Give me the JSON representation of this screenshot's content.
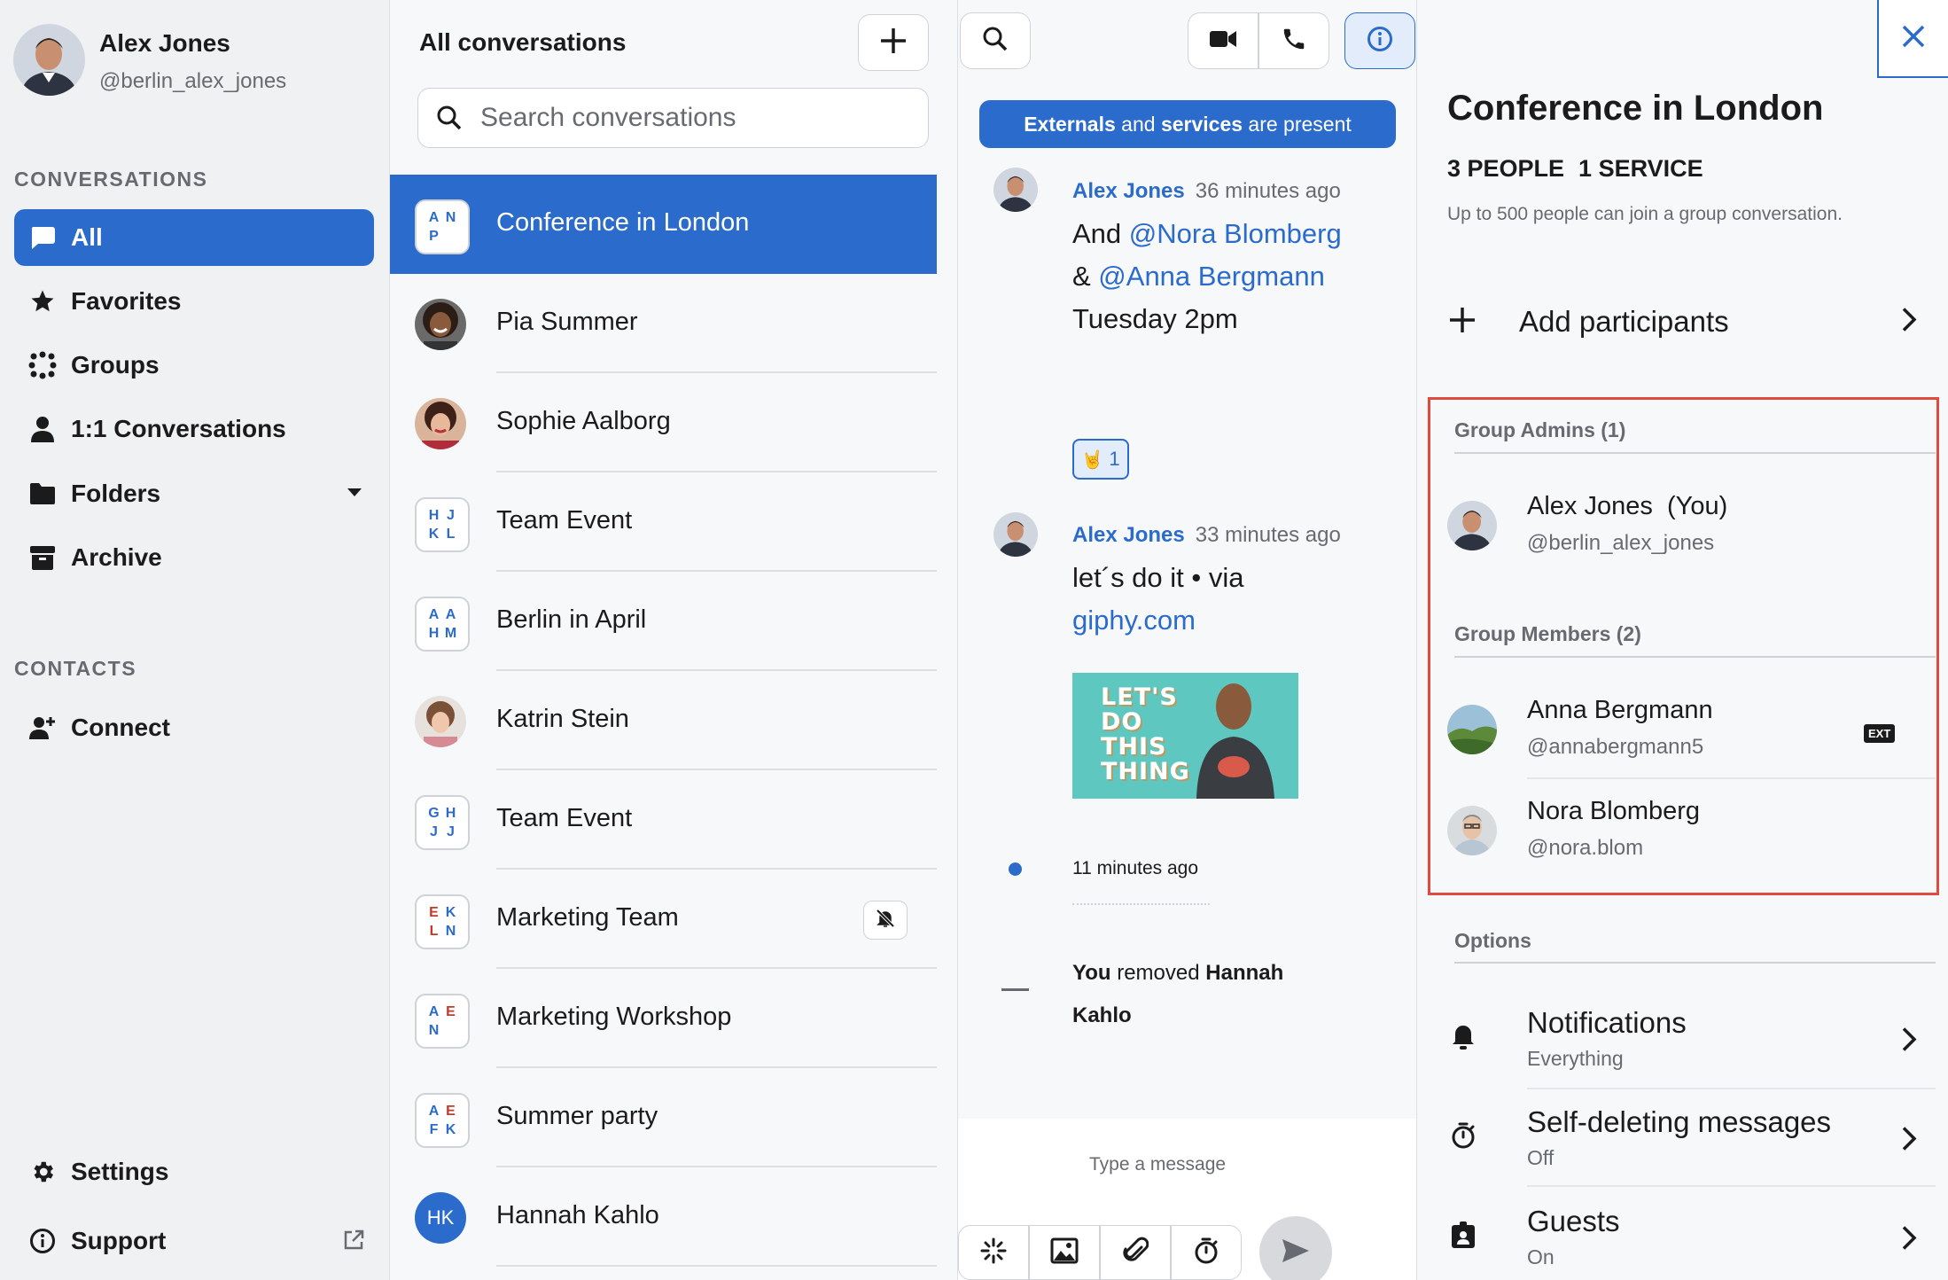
{
  "user": {
    "name": "Alex Jones",
    "handle": "@berlin_alex_jones"
  },
  "sidebar": {
    "conversations_heading": "CONVERSATIONS",
    "items": [
      {
        "label": "All",
        "icon": "chat-bubble-icon"
      },
      {
        "label": "Favorites",
        "icon": "star-icon"
      },
      {
        "label": "Groups",
        "icon": "groups-icon"
      },
      {
        "label": "1:1 Conversations",
        "icon": "person-icon"
      },
      {
        "label": "Folders",
        "icon": "folder-icon"
      },
      {
        "label": "Archive",
        "icon": "archive-icon"
      }
    ],
    "contacts_heading": "CONTACTS",
    "connect_label": "Connect",
    "settings_label": "Settings",
    "support_label": "Support"
  },
  "conversations": {
    "title": "All conversations",
    "search_placeholder": "Search conversations",
    "rows": [
      {
        "name": "Conference in London",
        "initials": [
          "A",
          "N",
          "P",
          ""
        ],
        "colors": [
          "#2b6bcb",
          "#2b6bcb",
          "#2b6bcb",
          "#2b6bcb"
        ]
      },
      {
        "name": "Pia Summer"
      },
      {
        "name": "Sophie Aalborg"
      },
      {
        "name": "Team Event",
        "initials": [
          "H",
          "J",
          "K",
          "L"
        ],
        "colors": [
          "#2b6bcb",
          "#2b6bcb",
          "#2b6bcb",
          "#2b6bcb"
        ]
      },
      {
        "name": "Berlin in April",
        "initials": [
          "A",
          "A",
          "H",
          "M"
        ],
        "colors": [
          "#2b6bcb",
          "#2b6bcb",
          "#2b6bcb",
          "#2b6bcb"
        ]
      },
      {
        "name": "Katrin Stein"
      },
      {
        "name": "Team Event",
        "initials": [
          "G",
          "H",
          "J",
          "J"
        ],
        "colors": [
          "#2b6bcb",
          "#2b6bcb",
          "#2b6bcb",
          "#2b6bcb"
        ]
      },
      {
        "name": "Marketing Team",
        "initials": [
          "E",
          "K",
          "L",
          "N"
        ],
        "colors": [
          "#c0392b",
          "#2b6bcb",
          "#c0392b",
          "#2b6bcb"
        ]
      },
      {
        "name": "Marketing Workshop",
        "initials": [
          "A",
          "E",
          "N",
          ""
        ],
        "colors": [
          "#2b6bcb",
          "#c0392b",
          "#2b6bcb",
          "#2b6bcb"
        ]
      },
      {
        "name": "Summer party",
        "initials": [
          "A",
          "E",
          "F",
          "K"
        ],
        "colors": [
          "#2b6bcb",
          "#c0392b",
          "#2b6bcb",
          "#2b6bcb"
        ]
      },
      {
        "name": "Hannah Kahlo",
        "badge": "HK"
      }
    ]
  },
  "chat": {
    "banner": {
      "b1": "Externals",
      "t1": " and ",
      "b2": "services",
      "t2": " are present"
    },
    "msg1": {
      "author": "Alex Jones",
      "time": "36 minutes ago",
      "t1": "And ",
      "m1": "@Nora Blomberg",
      "t2": " & ",
      "m2": "@Anna Bergmann",
      "t3": " Tuesday 2pm",
      "reaction_count": "1"
    },
    "msg2": {
      "author": "Alex Jones",
      "time": "33 minutes ago",
      "t1": "let´s do it • via ",
      "link": "giphy.com",
      "gif_text": "LET'S DO THIS THING"
    },
    "system_time": "11 minutes ago",
    "removed": {
      "you": "You",
      "text": " removed ",
      "name": "Hannah Kahlo"
    },
    "composer_placeholder": "Type a message"
  },
  "details": {
    "title": "Conference in London",
    "people": "3 PEOPLE",
    "services": "1 SERVICE",
    "note": "Up to 500 people can join a group conversation.",
    "add_participants": "Add participants",
    "admins_heading": "Group Admins (1)",
    "admins": [
      {
        "name": "Alex Jones",
        "you": "(You)",
        "handle": "@berlin_alex_jones"
      }
    ],
    "members_heading": "Group Members (2)",
    "members": [
      {
        "name": "Anna Bergmann",
        "handle": "@annabergmann5",
        "badge": "EXT"
      },
      {
        "name": "Nora Blomberg",
        "handle": "@nora.blom"
      }
    ],
    "options_heading": "Options",
    "options": [
      {
        "title": "Notifications",
        "value": "Everything",
        "icon": "bell-icon"
      },
      {
        "title": "Self-deleting messages",
        "value": "Off",
        "icon": "timer-icon"
      },
      {
        "title": "Guests",
        "value": "On",
        "icon": "guest-badge-icon"
      }
    ]
  },
  "colors": {
    "accent": "#2b6bcb",
    "highlight": "#e04a3f",
    "sidebar_bg": "#f0f1f2"
  }
}
